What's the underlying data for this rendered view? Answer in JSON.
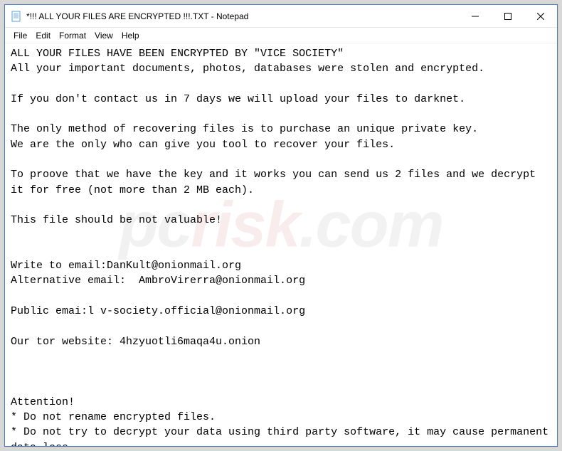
{
  "titlebar": {
    "title": "*!!! ALL YOUR FILES ARE ENCRYPTED !!!.TXT - Notepad"
  },
  "menubar": {
    "file": "File",
    "edit": "Edit",
    "format": "Format",
    "view": "View",
    "help": "Help"
  },
  "content": {
    "body": "ALL YOUR FILES HAVE BEEN ENCRYPTED BY \"VICE SOCIETY\"\nAll your important documents, photos, databases were stolen and encrypted.\n\nIf you don't contact us in 7 days we will upload your files to darknet.\n\nThe only method of recovering files is to purchase an unique private key.\nWe are the only who can give you tool to recover your files.\n\nTo proove that we have the key and it works you can send us 2 files and we decrypt it for free (not more than 2 MB each).\n\nThis file should be not valuable!\n\n\nWrite to email:DanKult@onionmail.org\nAlternative email:  AmbroVirerra@onionmail.org\n\nPublic emai:l v-society.official@onionmail.org\n\nOur tor website: 4hzyuotli6maqa4u.onion\n\n\n\nAttention!\n* Do not rename encrypted files.\n* Do not try to decrypt your data using third party software, it may cause permanent data loss.\n* Decryption of your files with the help of third parties may cause increased price (they add their fee to ours) or you can become a victim of a scam."
  },
  "watermark": {
    "pc": "pc",
    "risk": "risk",
    "com": ".com"
  }
}
